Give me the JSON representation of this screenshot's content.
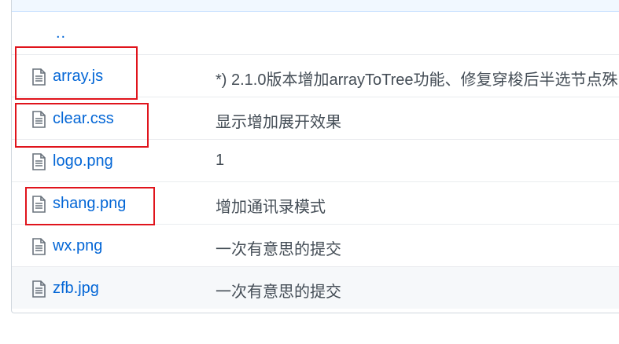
{
  "parent_dir_label": "..",
  "files": [
    {
      "name": "array.js",
      "icon": "file-text-icon",
      "message": "*) 2.1.0版本增加arrayToTree功能、修复穿梭后半选节点殊"
    },
    {
      "name": "clear.css",
      "icon": "file-text-icon",
      "message": "显示增加展开效果"
    },
    {
      "name": "logo.png",
      "icon": "file-text-icon",
      "message": "1"
    },
    {
      "name": "shang.png",
      "icon": "file-text-icon",
      "message": "增加通讯录模式"
    },
    {
      "name": "wx.png",
      "icon": "file-text-icon",
      "message": "一次有意思的提交"
    },
    {
      "name": "zfb.jpg",
      "icon": "file-text-icon",
      "message": "一次有意思的提交"
    }
  ],
  "colors": {
    "link": "#0366d6",
    "highlight_box": "#e0141c",
    "header_bg": "#f1f8ff"
  }
}
